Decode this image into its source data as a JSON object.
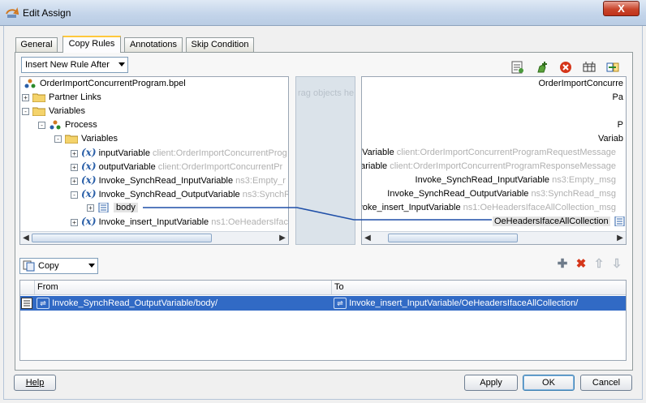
{
  "window": {
    "title": "Edit Assign",
    "close_label": "X"
  },
  "tabs": [
    {
      "label": "General"
    },
    {
      "label": "Copy Rules",
      "active": true
    },
    {
      "label": "Annotations"
    },
    {
      "label": "Skip Condition"
    }
  ],
  "insert_rule": {
    "value": "Insert New Rule After"
  },
  "mid_strip": {
    "hint": "rag objects he"
  },
  "left_tree": {
    "root": "OrderImportConcurrentProgram.bpel",
    "partner_links": "Partner Links",
    "variables": "Variables",
    "process": "Process",
    "process_variables": "Variables",
    "vars": [
      {
        "name": "inputVariable",
        "type": "client:OrderImportConcurrentProg"
      },
      {
        "name": "outputVariable",
        "type": "client:OrderImportConcurrentPr"
      },
      {
        "name": "Invoke_SynchRead_InputVariable",
        "type": "ns3:Empty_r"
      },
      {
        "name": "Invoke_SynchRead_OutputVariable",
        "type": "ns3:SynchR"
      },
      {
        "name": "Invoke_insert_InputVariable",
        "type": "ns1:OeHeadersIfac"
      }
    ],
    "body": "body"
  },
  "right_tree": {
    "root": "OrderImportConcurre",
    "partner_links": "Pa",
    "process": "P",
    "variables": "Variab",
    "vars": [
      {
        "name": "utVariable",
        "type": "client:OrderImportConcurrentProgramRequestMessage"
      },
      {
        "name": "tVariable",
        "type": "client:OrderImportConcurrentProgramResponseMessage"
      },
      {
        "name": "Invoke_SynchRead_InputVariable",
        "type": "ns3:Empty_msg"
      },
      {
        "name": "Invoke_SynchRead_OutputVariable",
        "type": "ns3:SynchRead_msg"
      },
      {
        "name": "nvoke_insert_InputVariable",
        "type": "ns1:OeHeadersIfaceAllCollection_msg"
      }
    ],
    "collection": "OeHeadersIfaceAllCollection"
  },
  "copy_op": {
    "value": "Copy"
  },
  "table": {
    "headers": {
      "from": "From",
      "to": "To"
    },
    "rows": [
      {
        "from": "Invoke_SynchRead_OutputVariable/body/",
        "to": "Invoke_insert_InputVariable/OeHeadersIfaceAllCollection/"
      }
    ]
  },
  "buttons": {
    "help": "Help",
    "apply": "Apply",
    "ok": "OK",
    "cancel": "Cancel"
  },
  "colors": {
    "selection": "#316ac5",
    "xpath": "#2a5fa8",
    "mapping_line": "#1f4fa8"
  }
}
